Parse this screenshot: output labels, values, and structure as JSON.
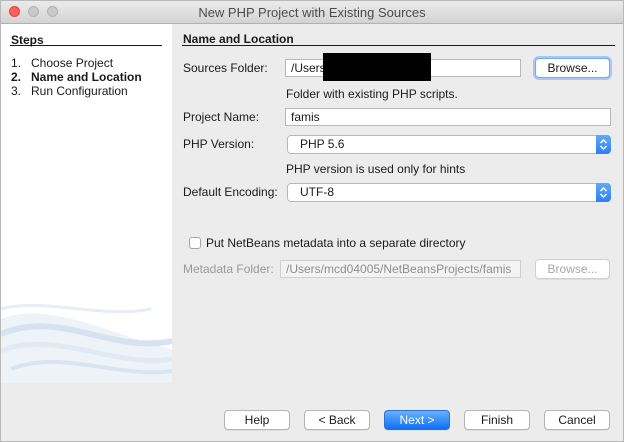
{
  "window": {
    "title": "New PHP Project with Existing Sources"
  },
  "steps": {
    "heading": "Steps",
    "items": [
      {
        "num": "1.",
        "label": "Choose Project"
      },
      {
        "num": "2.",
        "label": "Name and Location"
      },
      {
        "num": "3.",
        "label": "Run Configuration"
      }
    ]
  },
  "panel": {
    "heading": "Name and Location",
    "sources_folder_label": "Sources Folder:",
    "sources_folder_value": "/Users",
    "browse_label": "Browse...",
    "sources_hint": "Folder with existing PHP scripts.",
    "project_name_label": "Project Name:",
    "project_name_value": "famis",
    "php_version_label": "PHP Version:",
    "php_version_value": "PHP 5.6",
    "php_version_hint": "PHP version is used only for hints",
    "encoding_label": "Default Encoding:",
    "encoding_value": "UTF-8",
    "metadata_checkbox_label": "Put NetBeans metadata into a separate directory",
    "metadata_folder_label": "Metadata Folder:",
    "metadata_folder_value": "/Users/mcd04005/NetBeansProjects/famis",
    "metadata_browse_label": "Browse..."
  },
  "footer": {
    "help": "Help",
    "back": "< Back",
    "next": "Next >",
    "finish": "Finish",
    "cancel": "Cancel"
  }
}
